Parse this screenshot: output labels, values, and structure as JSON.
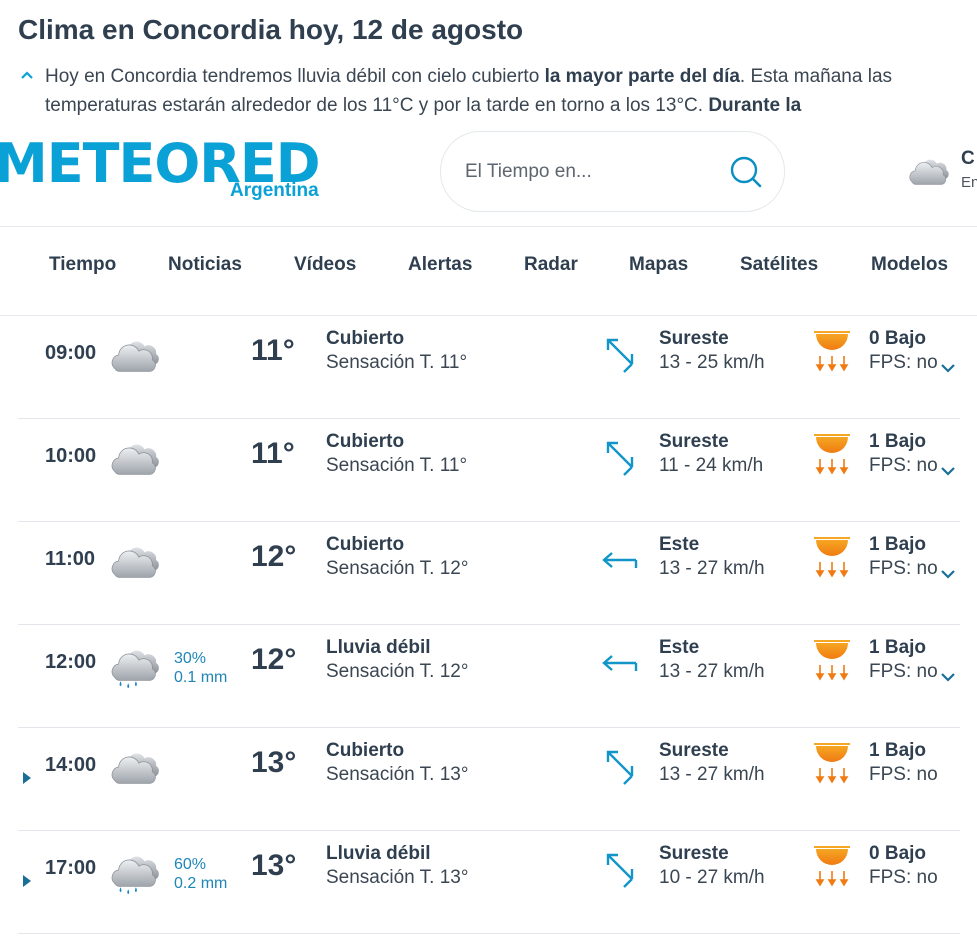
{
  "headline": "Clima en Concordia hoy, 12 de agosto",
  "summary": {
    "t1": "Hoy en Concordia tendremos lluvia débil con cielo cubierto ",
    "b1": "la mayor parte del día",
    "t2": ". Esta mañana las temperaturas estarán alrededor de los 11°C y por la tarde en torno a los 13°C. ",
    "b2": "Durante la"
  },
  "logo": {
    "word": "METEORED",
    "sub": "Argentina"
  },
  "search": {
    "placeholder": "El Tiempo en..."
  },
  "location": {
    "line1": "C",
    "line2": "En"
  },
  "nav": [
    "Tiempo",
    "Noticias",
    "Vídeos",
    "Alertas",
    "Radar",
    "Mapas",
    "Satélites",
    "Modelos"
  ],
  "colors": {
    "accent": "#0aa1d6",
    "text": "#2f3f4f",
    "precip": "#1f86b5",
    "uv": "#f29a1e"
  },
  "rows": [
    {
      "time": "09:00",
      "icon": "cloudy-icon",
      "precip_pct": "",
      "precip_mm": "",
      "temp": "11°",
      "desc": "Cubierto",
      "feel": "Sensación T. 11°",
      "wind_dir": "Sureste",
      "wind_speed": "13 - 25 km/h",
      "uv": "0 Bajo",
      "fps": "FPS: no",
      "expand": false
    },
    {
      "time": "10:00",
      "icon": "cloudy-icon",
      "precip_pct": "",
      "precip_mm": "",
      "temp": "11°",
      "desc": "Cubierto",
      "feel": "Sensación T. 11°",
      "wind_dir": "Sureste",
      "wind_speed": "11 - 24 km/h",
      "uv": "1 Bajo",
      "fps": "FPS: no",
      "expand": false
    },
    {
      "time": "11:00",
      "icon": "cloudy-icon",
      "precip_pct": "",
      "precip_mm": "",
      "temp": "12°",
      "desc": "Cubierto",
      "feel": "Sensación T. 12°",
      "wind_dir": "Este",
      "wind_speed": "13 - 27 km/h",
      "uv": "1 Bajo",
      "fps": "FPS: no",
      "expand": false
    },
    {
      "time": "12:00",
      "icon": "light-rain-icon",
      "precip_pct": "30%",
      "precip_mm": "0.1 mm",
      "temp": "12°",
      "desc": "Lluvia débil",
      "feel": "Sensación T. 12°",
      "wind_dir": "Este",
      "wind_speed": "13 - 27 km/h",
      "uv": "1 Bajo",
      "fps": "FPS: no",
      "expand": false
    },
    {
      "time": "14:00",
      "icon": "cloudy-icon",
      "precip_pct": "",
      "precip_mm": "",
      "temp": "13°",
      "desc": "Cubierto",
      "feel": "Sensación T. 13°",
      "wind_dir": "Sureste",
      "wind_speed": "13 - 27 km/h",
      "uv": "1 Bajo",
      "fps": "FPS: no",
      "expand": true
    },
    {
      "time": "17:00",
      "icon": "light-rain-icon",
      "precip_pct": "60%",
      "precip_mm": "0.2 mm",
      "temp": "13°",
      "desc": "Lluvia débil",
      "feel": "Sensación T. 13°",
      "wind_dir": "Sureste",
      "wind_speed": "10 - 27 km/h",
      "uv": "0 Bajo",
      "fps": "FPS: no",
      "expand": true
    }
  ]
}
